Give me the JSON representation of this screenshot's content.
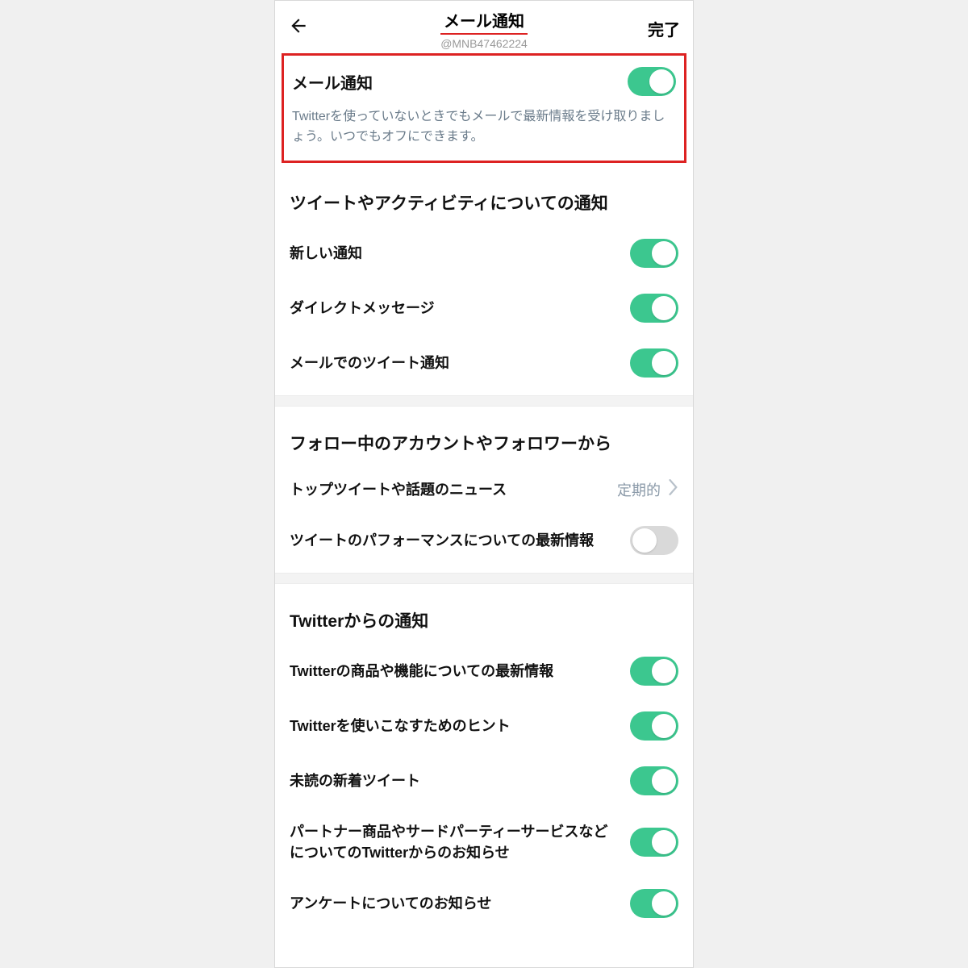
{
  "header": {
    "title": "メール通知",
    "subtitle": "@MNB47462224",
    "done": "完了"
  },
  "main": {
    "label": "メール通知",
    "desc": "Twitterを使っていないときでもメールで最新情報を受け取りましょう。いつでもオフにできます。"
  },
  "sections": {
    "s1": {
      "title": "ツイートやアクティビティについての通知",
      "r1": "新しい通知",
      "r2": "ダイレクトメッセージ",
      "r3": "メールでのツイート通知"
    },
    "s2": {
      "title": "フォロー中のアカウントやフォロワーから",
      "r1": "トップツイートや話題のニュース",
      "r1v": "定期的",
      "r2": "ツイートのパフォーマンスについての最新情報"
    },
    "s3": {
      "title": "Twitterからの通知",
      "r1": "Twitterの商品や機能についての最新情報",
      "r2": "Twitterを使いこなすためのヒント",
      "r3": "未読の新着ツイート",
      "r4": "パートナー商品やサードパーティーサービスなどについてのTwitterからのお知らせ",
      "r5": "アンケートについてのお知らせ"
    }
  }
}
